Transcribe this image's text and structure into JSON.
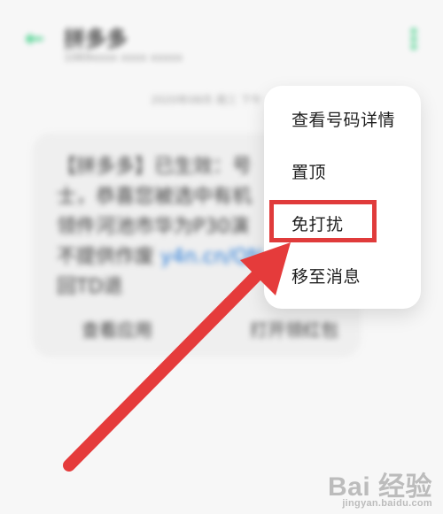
{
  "header": {
    "contact_name": "拼多多",
    "contact_sub": "1069xxxx xxxx xxxxx"
  },
  "conversation": {
    "timestamp": "2020年08月 周三 下午",
    "message_lines": [
      "【拼多多】已生效：号",
      "士，恭喜您被选中有机",
      "领件河池市华为P30演",
      "不提供作废"
    ],
    "message_link": "y4n.cn/QN",
    "message_tail": "回TD退",
    "action_left": "查看应用",
    "action_right": "打开领红包"
  },
  "menu": {
    "items": [
      "查看号码详情",
      "置顶",
      "免打扰",
      "移至消息"
    ]
  },
  "annotation": {
    "highlight_color": "#e03b3b",
    "arrow_color": "#e53b3b"
  },
  "watermark": {
    "brand": "Bai 经验",
    "site": "jingyan.baidu.com"
  }
}
